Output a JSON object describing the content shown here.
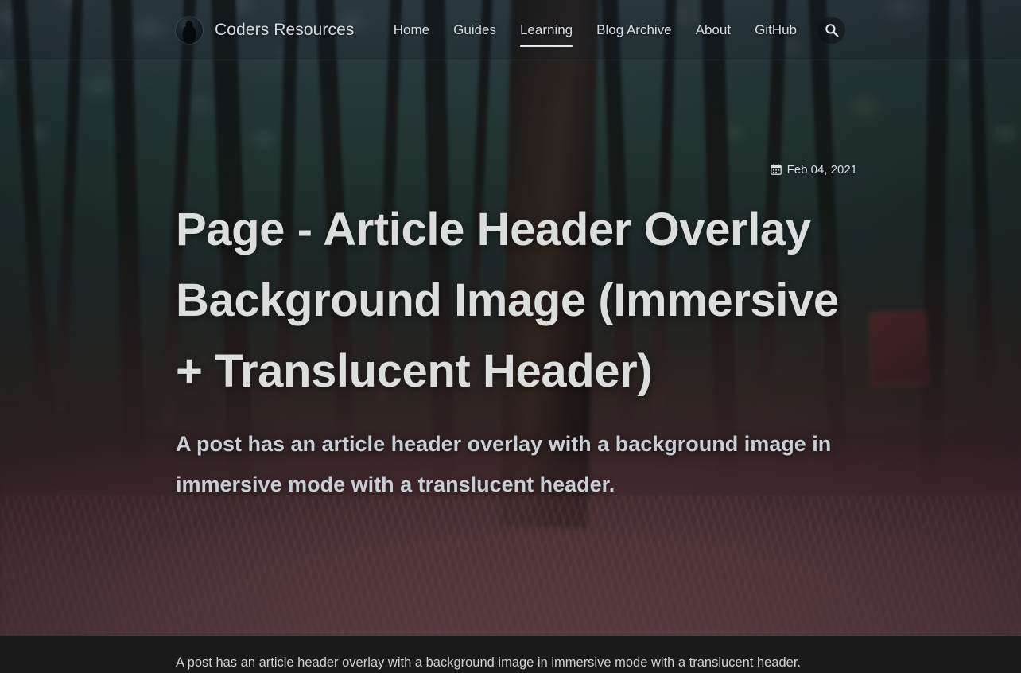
{
  "site": {
    "brand_name": "Coders Resources",
    "logo_icon": "owl-avatar-logo"
  },
  "header": {
    "nav_items": [
      {
        "label": "Home",
        "active": false
      },
      {
        "label": "Guides",
        "active": false
      },
      {
        "label": "Learning",
        "active": true
      },
      {
        "label": "Blog Archive",
        "active": false
      },
      {
        "label": "About",
        "active": false
      },
      {
        "label": "GitHub",
        "active": false
      }
    ],
    "search_icon": "search-icon",
    "translucent": true
  },
  "article": {
    "date_icon": "calendar-icon",
    "date": "Feb 04, 2021",
    "title": "Page - Article Header Overlay Background Image (Immersive + Translucent Header)",
    "subtitle": "A post has an article header overlay with a background image in immersive mode with a translucent header.",
    "body_text": "A post has an article header overlay with a background image in immersive mode with a translucent header."
  },
  "colors": {
    "header_text": "#d7dde2",
    "title_text": "#dcdedd",
    "subtitle_text": "#c8ced4",
    "body_background": "#1a1a1a",
    "body_text": "#cfd2d4",
    "active_underline": "#e2e7ea"
  }
}
